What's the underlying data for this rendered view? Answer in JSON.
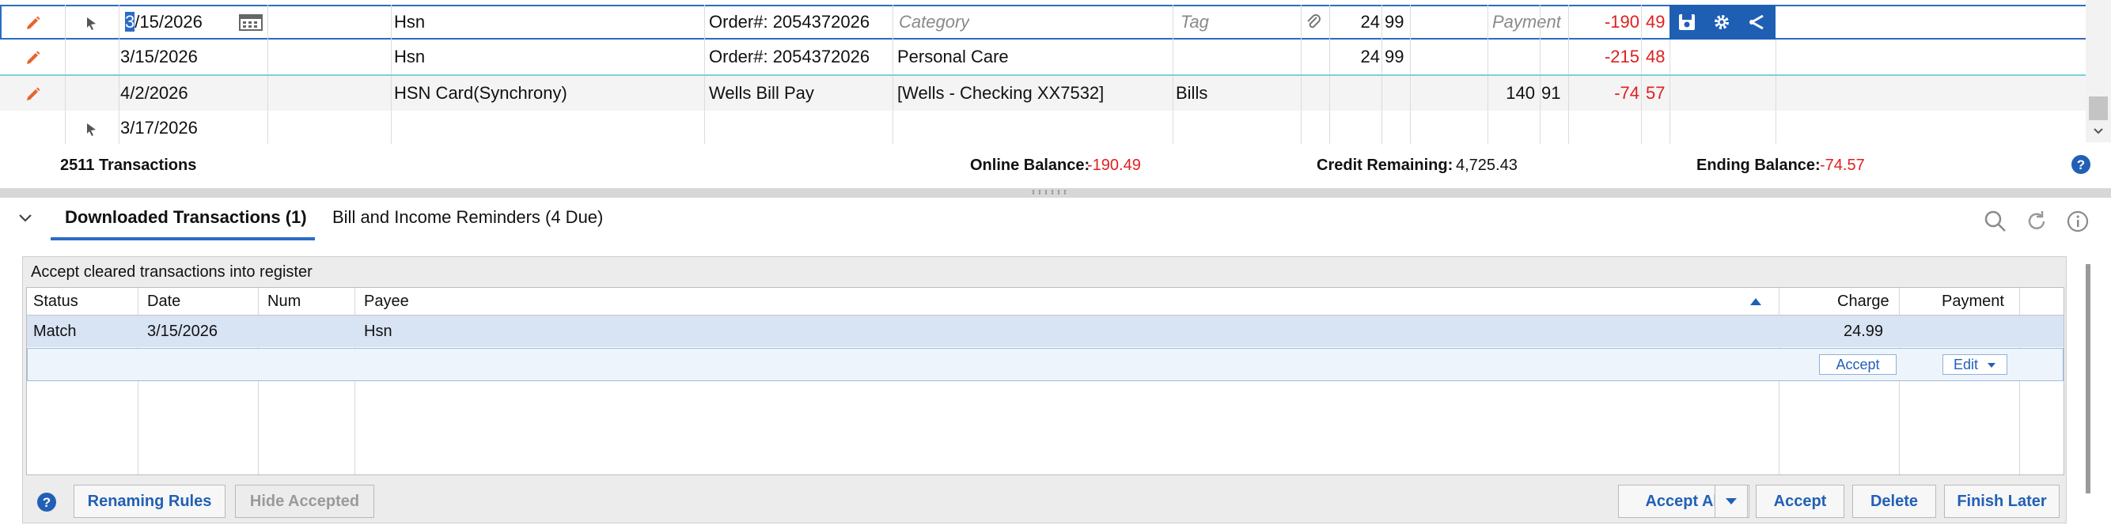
{
  "register": {
    "rows": [
      {
        "date": "3/15/2026",
        "payee": "Hsn",
        "memo": "Order#: 2054372026",
        "category_placeholder": "Category",
        "tag_placeholder": "Tag",
        "charge_dollars": "24",
        "charge_cents": "99",
        "payment_placeholder": "Payment",
        "balance_dollars": "-190",
        "balance_cents": "49"
      },
      {
        "date": "3/15/2026",
        "payee": "Hsn",
        "memo": "Order#: 2054372026",
        "category": "Personal Care",
        "charge_dollars": "24",
        "charge_cents": "99",
        "balance_dollars": "-215",
        "balance_cents": "48"
      },
      {
        "date": "4/2/2026",
        "payee": "HSN Card(Synchrony)",
        "memo": "Wells Bill Pay",
        "category": "[Wells - Checking XX7532]",
        "tag": "Bills",
        "payment_dollars": "140",
        "payment_cents": "91",
        "balance_dollars": "-74",
        "balance_cents": "57"
      },
      {
        "date": "3/17/2026"
      }
    ]
  },
  "summary": {
    "transactions": "2511 Transactions",
    "online_balance_label": "Online Balance:",
    "online_balance": "-190.49",
    "credit_remaining_label": "Credit Remaining:",
    "credit_remaining": "4,725.43",
    "ending_balance_label": "Ending Balance:",
    "ending_balance": "-74.57"
  },
  "tabs": [
    {
      "label": "Downloaded Transactions (1)"
    },
    {
      "label": "Bill and Income Reminders (4 Due)"
    }
  ],
  "downloaded": {
    "caption": "Accept cleared transactions into register",
    "columns": {
      "status": "Status",
      "date": "Date",
      "num": "Num",
      "payee": "Payee",
      "charge": "Charge",
      "payment": "Payment"
    },
    "rows": [
      {
        "status": "Match",
        "date": "3/15/2026",
        "num": "",
        "payee": "Hsn",
        "charge": "24.99",
        "payment": ""
      }
    ],
    "row_accept": "Accept",
    "row_edit": "Edit"
  },
  "buttons": {
    "renaming_rules": "Renaming Rules",
    "hide_accepted": "Hide Accepted",
    "accept_all": "Accept All",
    "accept": "Accept",
    "delete": "Delete",
    "finish_later": "Finish Later"
  },
  "colors": {
    "accent": "#2b6cc4",
    "negative": "#e02020",
    "selected_row": "#d8e3f3"
  },
  "icons": [
    "pencil-icon",
    "flag-icon",
    "calendar-icon",
    "paperclip-icon",
    "save-icon",
    "gear-icon",
    "share-icon",
    "help-icon",
    "search-icon",
    "refresh-icon",
    "info-icon",
    "chevron-down-icon",
    "sort-up-icon"
  ]
}
